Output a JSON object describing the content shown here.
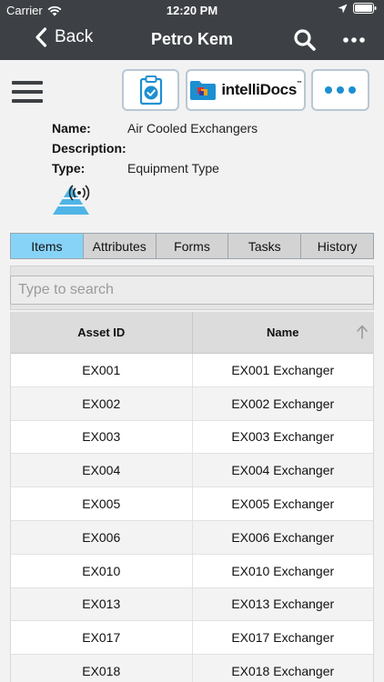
{
  "status_bar": {
    "carrier": "Carrier",
    "time": "12:20 PM"
  },
  "nav": {
    "back_label": "Back",
    "title": "Petro Kem"
  },
  "toolbar": {
    "docs_label": "intelliDocs",
    "docs_tm": "™"
  },
  "details": {
    "name_label": "Name:",
    "name_value": "Air Cooled Exchangers",
    "description_label": "Description:",
    "description_value": "",
    "type_label": "Type:",
    "type_value": "Equipment Type"
  },
  "tabs": [
    {
      "label": "Items",
      "active": true
    },
    {
      "label": "Attributes",
      "active": false
    },
    {
      "label": "Forms",
      "active": false
    },
    {
      "label": "Tasks",
      "active": false
    },
    {
      "label": "History",
      "active": false
    }
  ],
  "search": {
    "placeholder": "Type to search"
  },
  "grid": {
    "columns": [
      "Asset ID",
      "Name"
    ],
    "rows": [
      [
        "EX001",
        "EX001 Exchanger"
      ],
      [
        "EX002",
        "EX002 Exchanger"
      ],
      [
        "EX003",
        "EX003 Exchanger"
      ],
      [
        "EX004",
        "EX004 Exchanger"
      ],
      [
        "EX005",
        "EX005 Exchanger"
      ],
      [
        "EX006",
        "EX006 Exchanger"
      ],
      [
        "EX010",
        "EX010 Exchanger"
      ],
      [
        "EX013",
        "EX013 Exchanger"
      ],
      [
        "EX017",
        "EX017 Exchanger"
      ],
      [
        "EX018",
        "EX018 Exchanger"
      ]
    ]
  },
  "colors": {
    "nav_bg": "#3d4044",
    "tab_active": "#87d3f8",
    "button_border": "#b9c7d4",
    "accent_blue": "#1d8fd1"
  },
  "icons": {
    "back": "chevron-left-icon",
    "search": "search-icon",
    "more": "more-horizontal-icon",
    "menu": "hamburger-icon",
    "clipboard": "clipboard-check-icon",
    "folder": "folder-icon",
    "type": "pyramid-rfid-icon",
    "sort": "sort-arrow-up-icon"
  }
}
